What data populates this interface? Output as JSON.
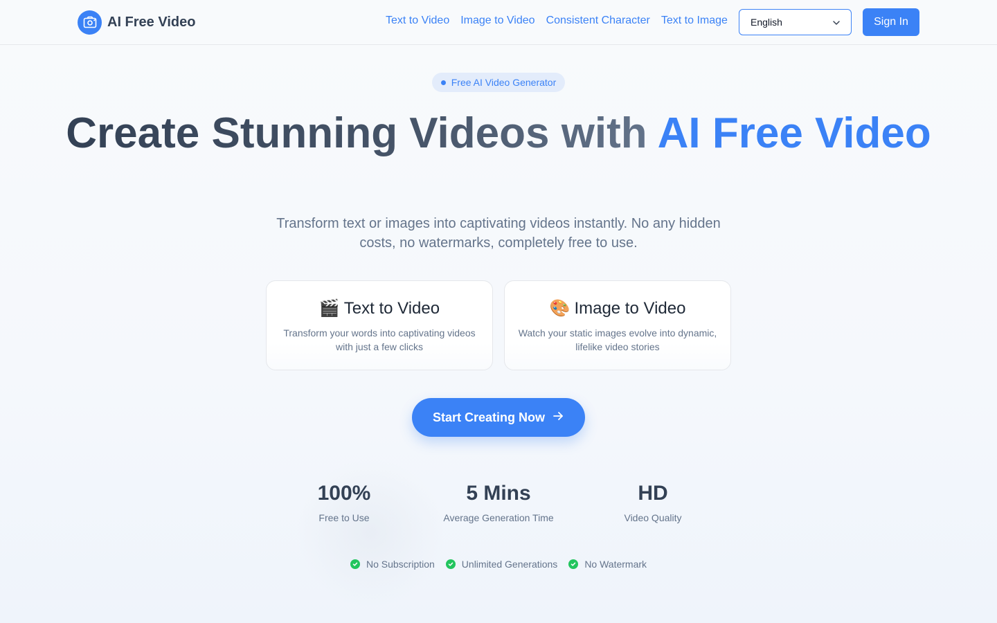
{
  "header": {
    "brand": "AI Free Video",
    "nav": [
      "Text to Video",
      "Image to Video",
      "Consistent Character",
      "Text to Image"
    ],
    "language": "English",
    "sign_in": "Sign In"
  },
  "hero": {
    "badge": "Free AI Video Generator",
    "title_part1": "Create Stunning Videos with ",
    "title_accent": "AI Free Video",
    "subtitle": "Transform text or images into captivating videos instantly. No any hidden costs, no watermarks, completely free to use."
  },
  "cards": [
    {
      "icon": "🎬",
      "icon_name": "clapperboard-icon",
      "title": "Text to Video",
      "desc": "Transform your words into captivating videos with just a few clicks"
    },
    {
      "icon": "🎨",
      "icon_name": "palette-icon",
      "title": "Image to Video",
      "desc": "Watch your static images evolve into dynamic, lifelike video stories"
    }
  ],
  "cta": "Start Creating Now",
  "stats": [
    {
      "value": "100%",
      "label": "Free to Use"
    },
    {
      "value": "5 Mins",
      "label": "Average Generation Time"
    },
    {
      "value": "HD",
      "label": "Video Quality"
    }
  ],
  "features": [
    "No Subscription",
    "Unlimited Generations",
    "No Watermark"
  ],
  "colors": {
    "accent": "#3b82f6",
    "check": "#22c55e",
    "text": "#334155",
    "muted": "#64748b"
  }
}
